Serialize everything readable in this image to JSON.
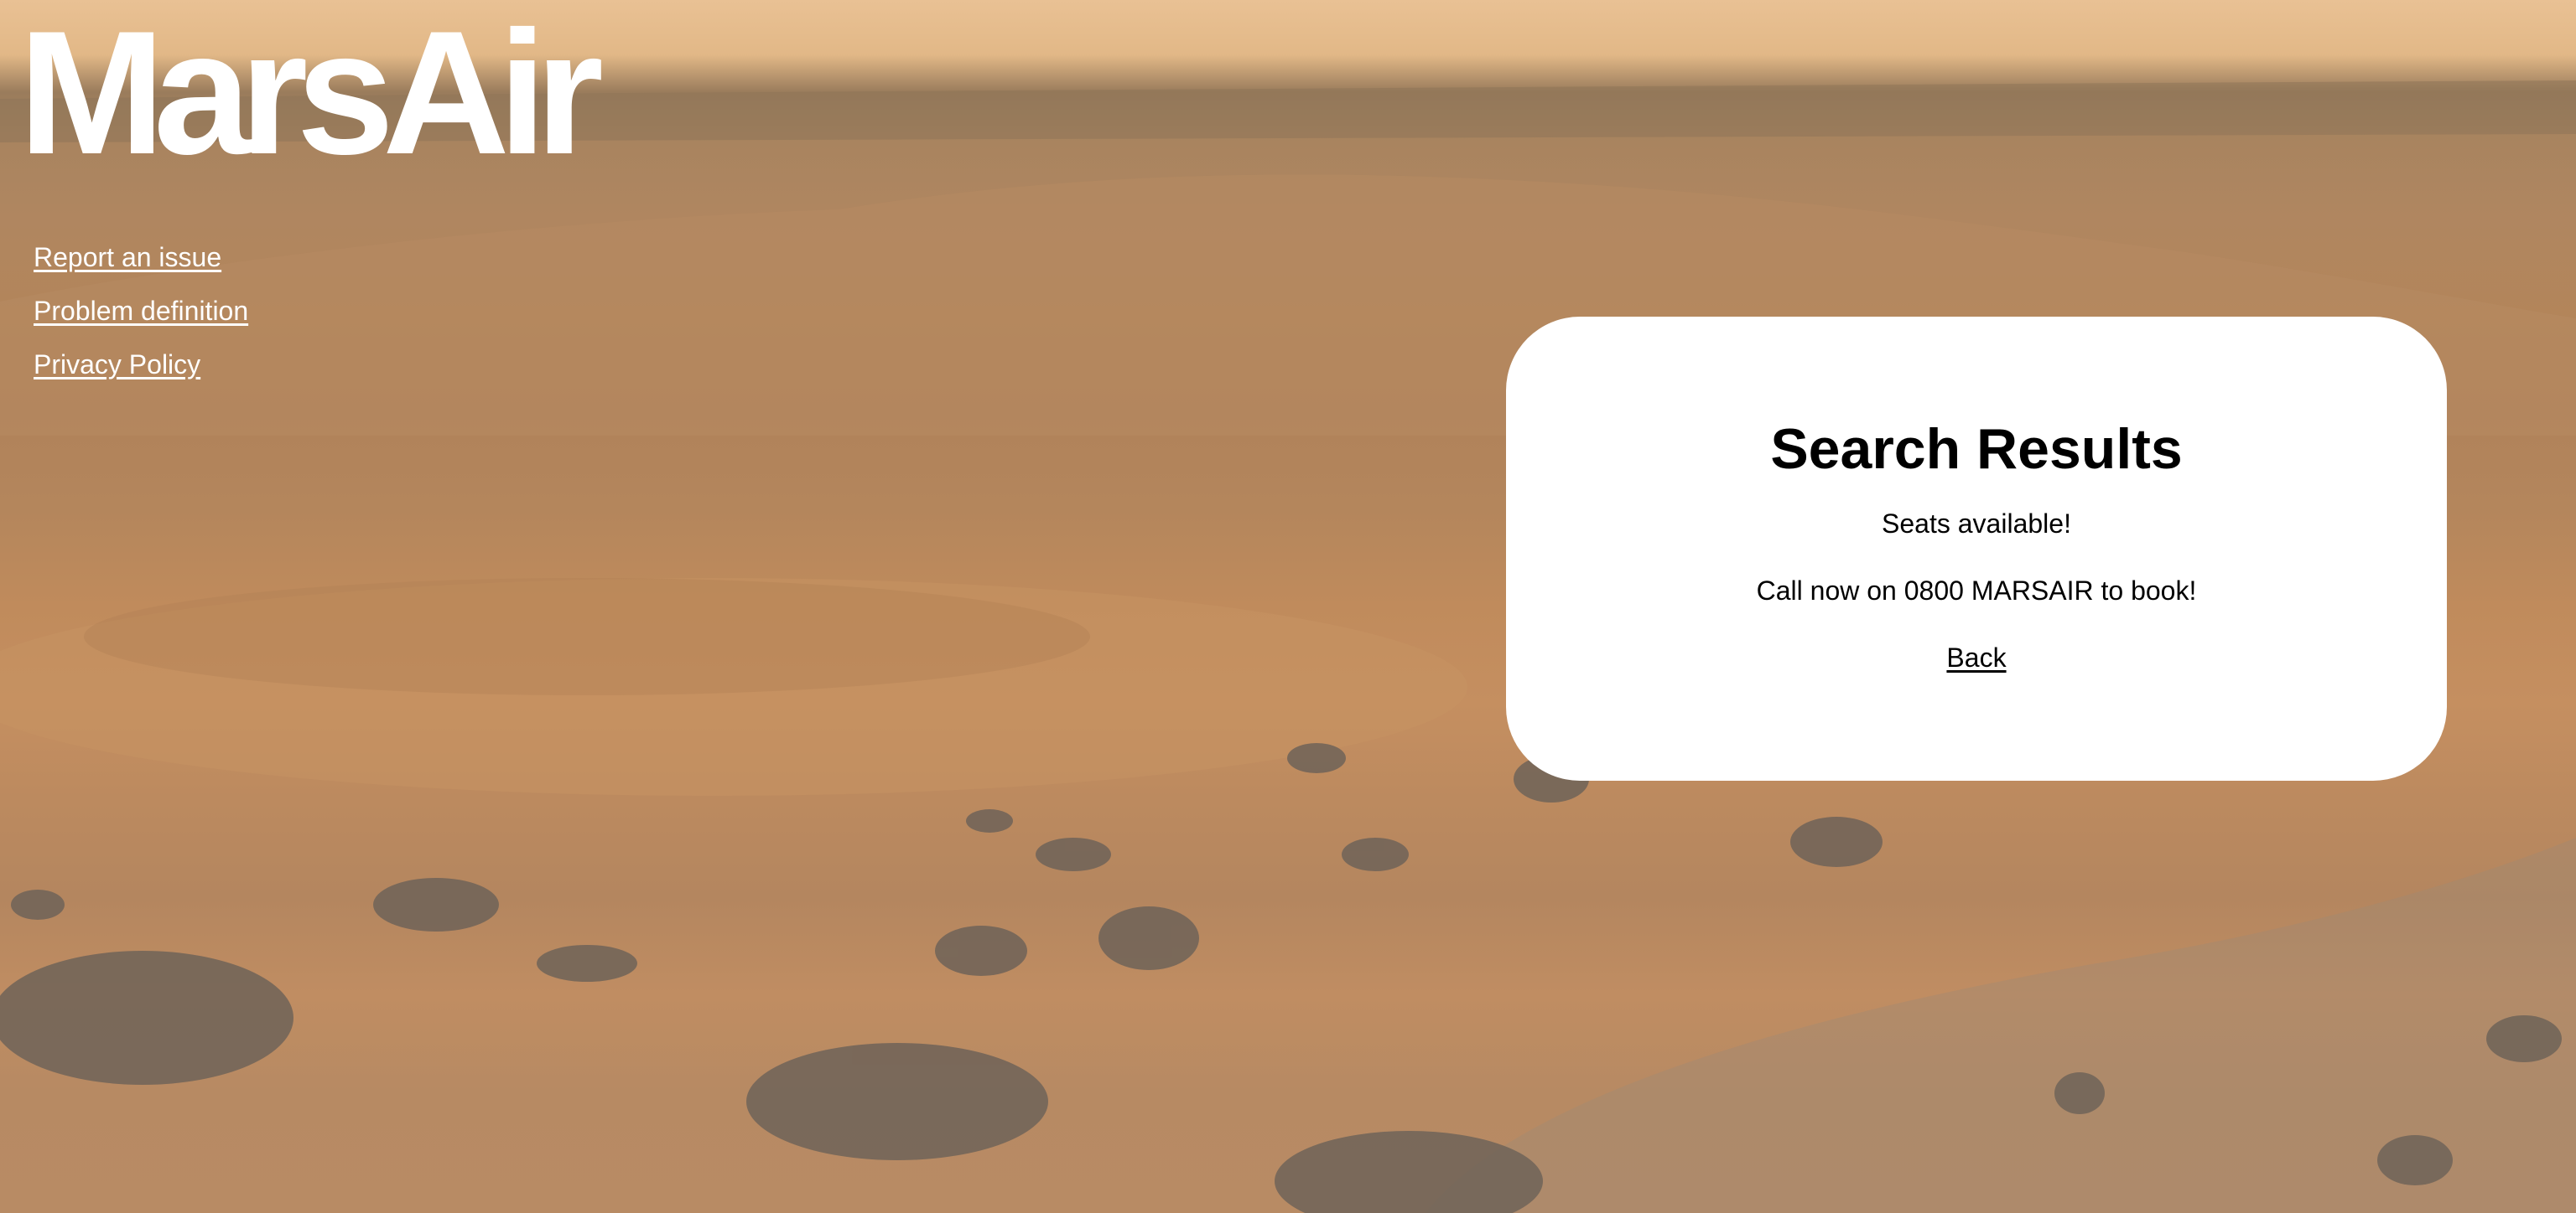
{
  "brand": {
    "logo_text": "MarsAir"
  },
  "sidebar": {
    "links": [
      {
        "label": "Report an issue"
      },
      {
        "label": "Problem definition"
      },
      {
        "label": "Privacy Policy"
      }
    ]
  },
  "results": {
    "title": "Search Results",
    "availability": "Seats available!",
    "call_to_action": "Call now on 0800 MARSAIR to book!",
    "back_label": "Back"
  },
  "colors": {
    "text_on_background": "#ffffff",
    "card_background": "#ffffff",
    "card_text": "#000000"
  }
}
